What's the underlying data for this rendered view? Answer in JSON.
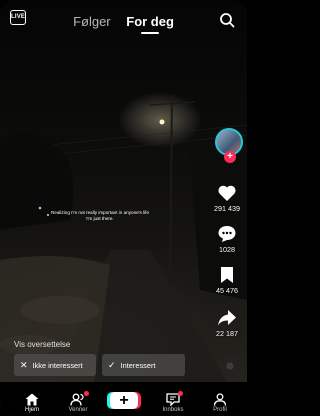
{
  "topbar": {
    "live_label": "LIVE",
    "tabs": [
      {
        "label": "Følger"
      },
      {
        "label": "For deg",
        "active": true
      }
    ]
  },
  "video": {
    "caption": "Realizing I'm not really important in anyone's life I'm just there."
  },
  "actions": {
    "likes": "291 439",
    "comments": "1028",
    "saves": "45 476",
    "shares": "22 187"
  },
  "translation": {
    "label": "Vis oversettelse",
    "not_interested": "Ikke interessert",
    "interested": "Interessert"
  },
  "nav": {
    "home": "Hjem",
    "friends": "Venner",
    "inbox": "Innboks",
    "profile": "Profil"
  },
  "colors": {
    "accent_red": "#fe2c55",
    "accent_cyan": "#25f4ee",
    "avatar_ring": "#29c4d6"
  },
  "icons": [
    "live-icon",
    "search-icon",
    "heart-icon",
    "comment-icon",
    "bookmark-icon",
    "share-icon",
    "close-icon",
    "check-icon",
    "home-icon",
    "friends-icon",
    "plus-icon",
    "inbox-icon",
    "profile-icon"
  ]
}
